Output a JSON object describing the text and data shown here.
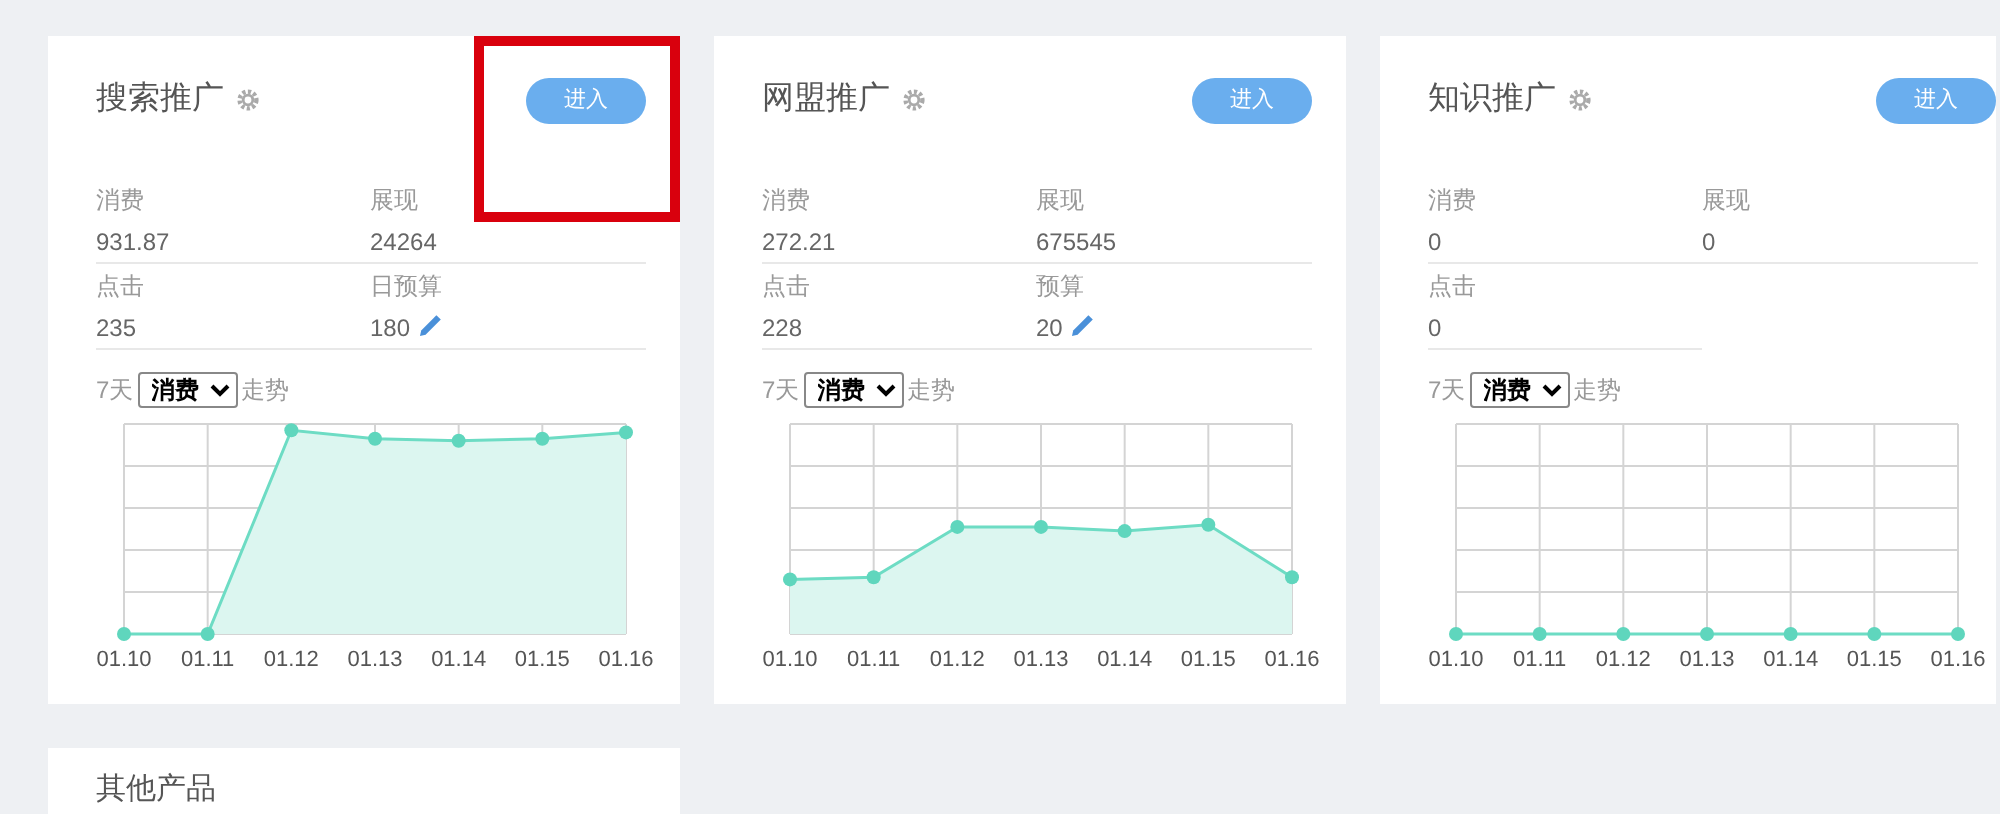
{
  "cards": [
    {
      "title": "搜索推广",
      "button": "进入",
      "highlighted": true,
      "stats": [
        {
          "label": "消费",
          "value": "931.87",
          "editable": false
        },
        {
          "label": "展现",
          "value": "24264",
          "editable": false
        },
        {
          "label": "点击",
          "value": "235",
          "editable": false
        },
        {
          "label": "日预算",
          "value": "180",
          "editable": true
        }
      ],
      "trend": {
        "prefix": "7天",
        "metric": "消费",
        "suffix": "走势",
        "x_labels": [
          "01.10",
          "01.11",
          "01.12",
          "01.13",
          "01.14",
          "01.15",
          "01.16"
        ]
      }
    },
    {
      "title": "网盟推广",
      "button": "进入",
      "highlighted": false,
      "stats": [
        {
          "label": "消费",
          "value": "272.21",
          "editable": false
        },
        {
          "label": "展现",
          "value": "675545",
          "editable": false
        },
        {
          "label": "点击",
          "value": "228",
          "editable": false
        },
        {
          "label": "预算",
          "value": "20",
          "editable": true
        }
      ],
      "trend": {
        "prefix": "7天",
        "metric": "消费",
        "suffix": "走势",
        "x_labels": [
          "01.10",
          "01.11",
          "01.12",
          "01.13",
          "01.14",
          "01.15",
          "01.16"
        ]
      }
    },
    {
      "title": "知识推广",
      "button": "进入",
      "highlighted": false,
      "stats": [
        {
          "label": "消费",
          "value": "0",
          "editable": false
        },
        {
          "label": "展现",
          "value": "0",
          "editable": false
        },
        {
          "label": "点击",
          "value": "0",
          "editable": false
        }
      ],
      "trend": {
        "prefix": "7天",
        "metric": "消费",
        "suffix": "走势",
        "x_labels": [
          "01.10",
          "01.11",
          "01.12",
          "01.13",
          "01.14",
          "01.15",
          "01.16"
        ]
      }
    }
  ],
  "other_card": {
    "title": "其他产品"
  }
}
